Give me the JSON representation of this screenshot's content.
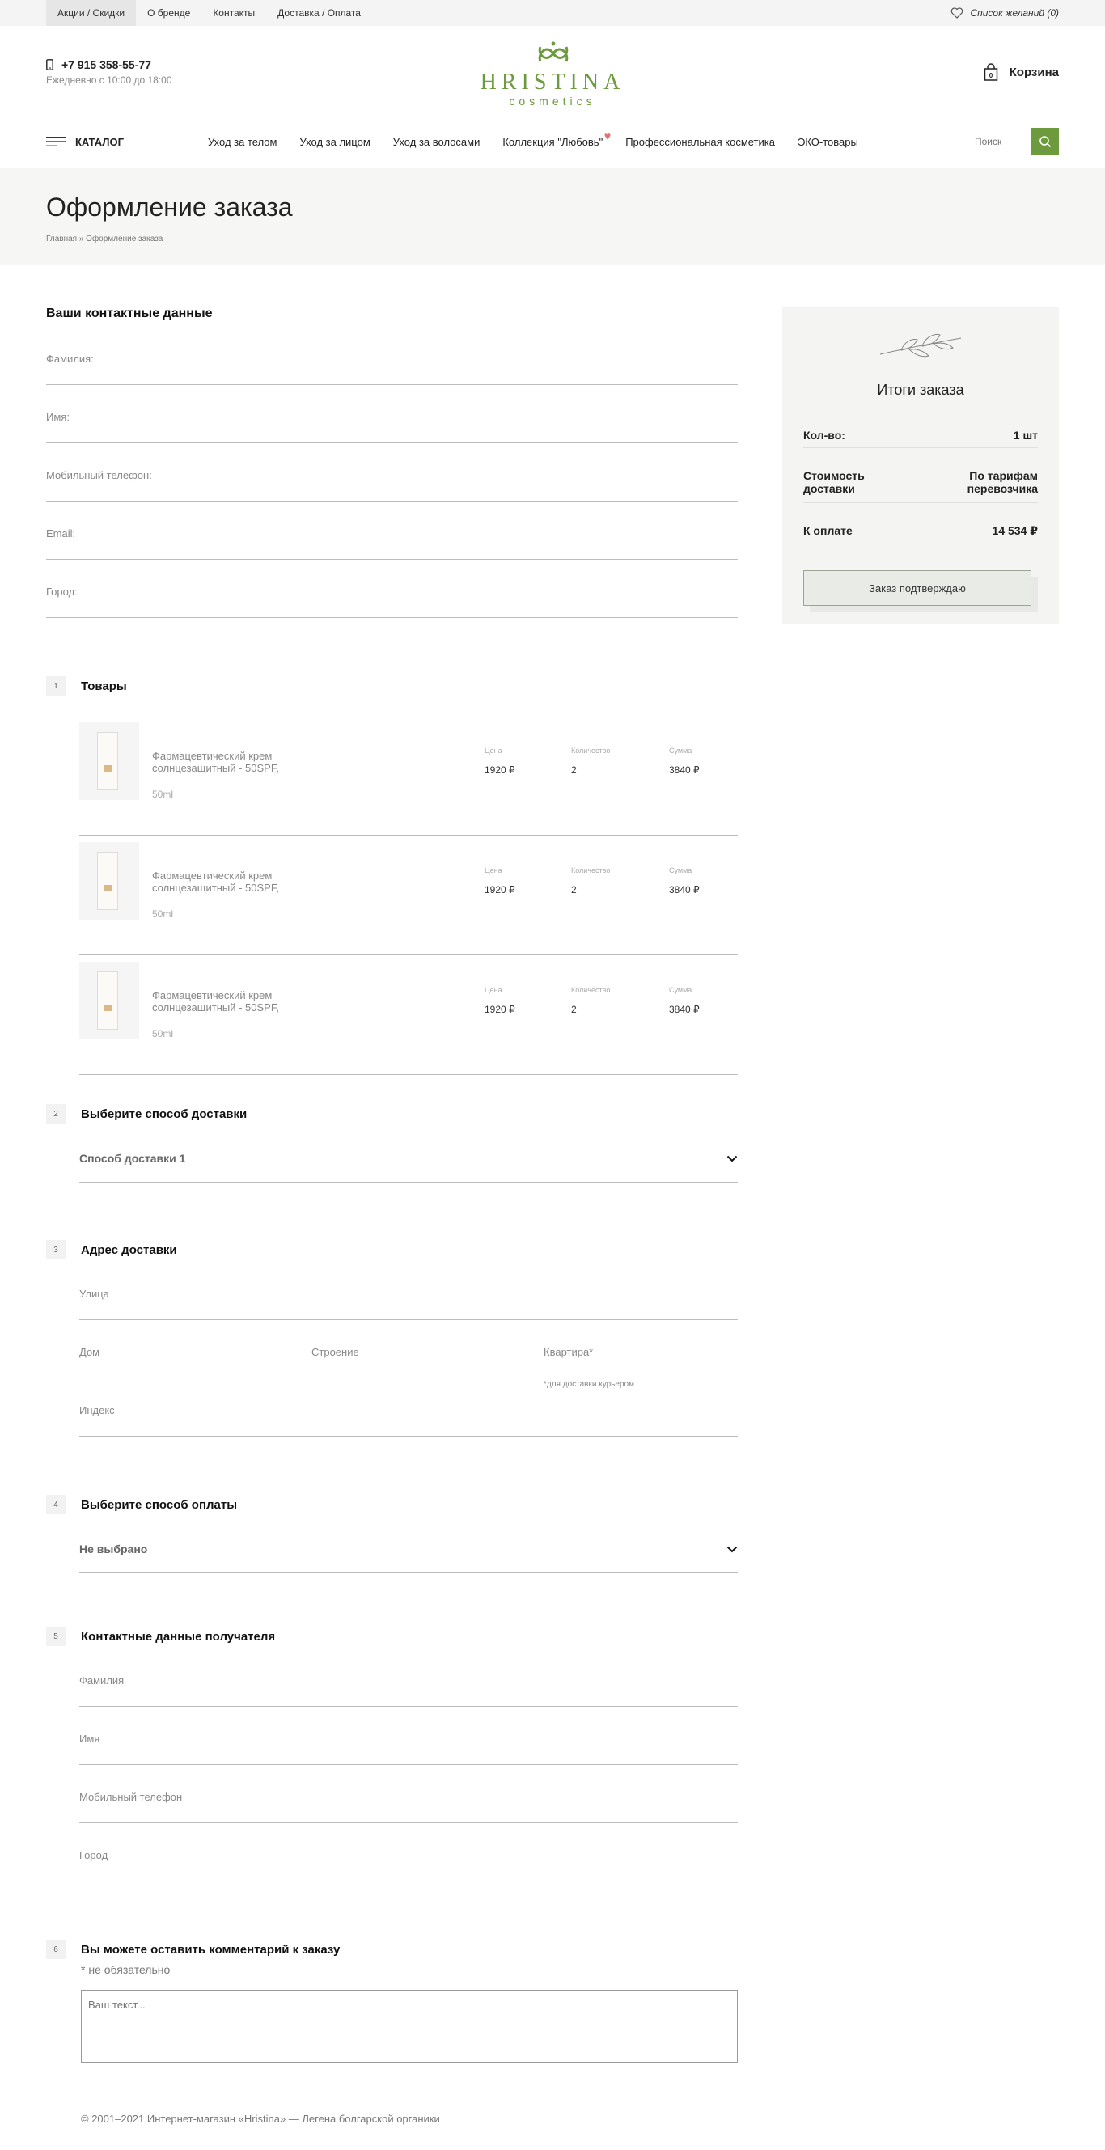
{
  "topbar": {
    "links": [
      "Акции / Скидки",
      "О бренде",
      "Контакты",
      "Доставка / Оплата"
    ],
    "wishlist": "Список желаний (0)"
  },
  "header": {
    "phone": "+7 915 358-55-77",
    "hours": "Ежедневно с 10:00 до 18:00",
    "brand": "HRISTINA",
    "brand_sub": "cosmetics",
    "cart_label": "Корзина",
    "cart_count": "0"
  },
  "nav": {
    "catalog": "Каталог",
    "items": [
      "Уход за телом",
      "Уход за лицом",
      "Уход за волосами",
      "Коллекция \"Любовь\"",
      "Профессиональная косметика",
      "ЭКО-товары"
    ],
    "search_placeholder": "Поиск"
  },
  "page": {
    "title": "Оформление заказа",
    "breadcrumb": "Главная » Оформление заказа"
  },
  "contacts": {
    "title": "Ваши контактные данные",
    "fields": [
      "Фамилия:",
      "Имя:",
      "Мобильный телефон:",
      "Email:",
      "Город:"
    ]
  },
  "summary": {
    "title": "Итоги заказа",
    "qty_label": "Кол-во:",
    "qty_value": "1 шт",
    "delivery_label": "Стоимость доставки",
    "delivery_value": "По тарифам перевозчика",
    "total_label": "К оплате",
    "total_value": "14 534 ₽",
    "confirm": "Заказ подтверждаю"
  },
  "goods": {
    "num": "1",
    "title": "Товары",
    "col_price": "Цена",
    "col_qty": "Количество",
    "col_sum": "Сумма",
    "items": [
      {
        "name": "Фармацевтический крем солнцезащитный - 50SPF,",
        "volume": "50ml",
        "price": "1920 ₽",
        "qty": "2",
        "sum": "3840 ₽"
      },
      {
        "name": "Фармацевтический крем солнцезащитный - 50SPF,",
        "volume": "50ml",
        "price": "1920 ₽",
        "qty": "2",
        "sum": "3840 ₽"
      },
      {
        "name": "Фармацевтический крем солнцезащитный - 50SPF,",
        "volume": "50ml",
        "price": "1920 ₽",
        "qty": "2",
        "sum": "3840 ₽"
      }
    ]
  },
  "delivery": {
    "num": "2",
    "title": "Выберите способ доставки",
    "selected": "Способ доставки 1"
  },
  "address": {
    "num": "3",
    "title": "Адрес доставки",
    "street": "Улица",
    "house": "Дом",
    "building": "Строение",
    "apartment": "Квартира*",
    "apartment_note": "*для доставки курьером",
    "index": "Индекс"
  },
  "payment": {
    "num": "4",
    "title": "Выберите способ оплаты",
    "selected": "Не выбрано"
  },
  "recipient": {
    "num": "5",
    "title": "Контактные данные получателя",
    "fields": [
      "Фамилия",
      "Имя",
      "Мобильный телефон",
      "Город"
    ]
  },
  "comment": {
    "num": "6",
    "title": "Вы можете оставить комментарий к заказу",
    "optional": "* не обязательно",
    "placeholder": "Ваш текст..."
  },
  "footer": {
    "copyright": "© 2001–2021 Интернет-магазин «Hristina» — Легена болгарской органики"
  },
  "colors": {
    "accent": "#6c9a3d",
    "heart": "#e86f6f"
  }
}
